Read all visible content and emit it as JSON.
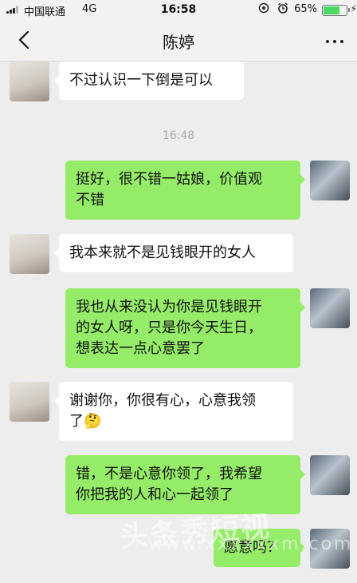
{
  "status_bar": {
    "carrier": "中国联通",
    "network": "4G",
    "time": "16:58",
    "battery": "65%"
  },
  "nav": {
    "title": "陈婷"
  },
  "chat": {
    "timestamp": "16:48",
    "messages": [
      {
        "side": "left",
        "text": "不过认识一下倒是可以"
      },
      {
        "side": "right",
        "text": "挺好，很不错一姑娘，价值观\n不错"
      },
      {
        "side": "left",
        "text": "我本来就不是见钱眼开的女人"
      },
      {
        "side": "right",
        "text": "我也从来没认为你是见钱眼开\n的女人呀，只是你今天生日，\n想表达一点心意罢了"
      },
      {
        "side": "left",
        "text": "谢谢你，你很有心，心意我领\n了🤔"
      },
      {
        "side": "right",
        "text": "错，不是心意你领了，我希望\n你把我的人和心一起领了"
      },
      {
        "side": "right",
        "text": "愿意吗？"
      }
    ]
  },
  "watermark": {
    "line1": "头条秀短视",
    "line2": "www.xxxxxxm.com"
  }
}
